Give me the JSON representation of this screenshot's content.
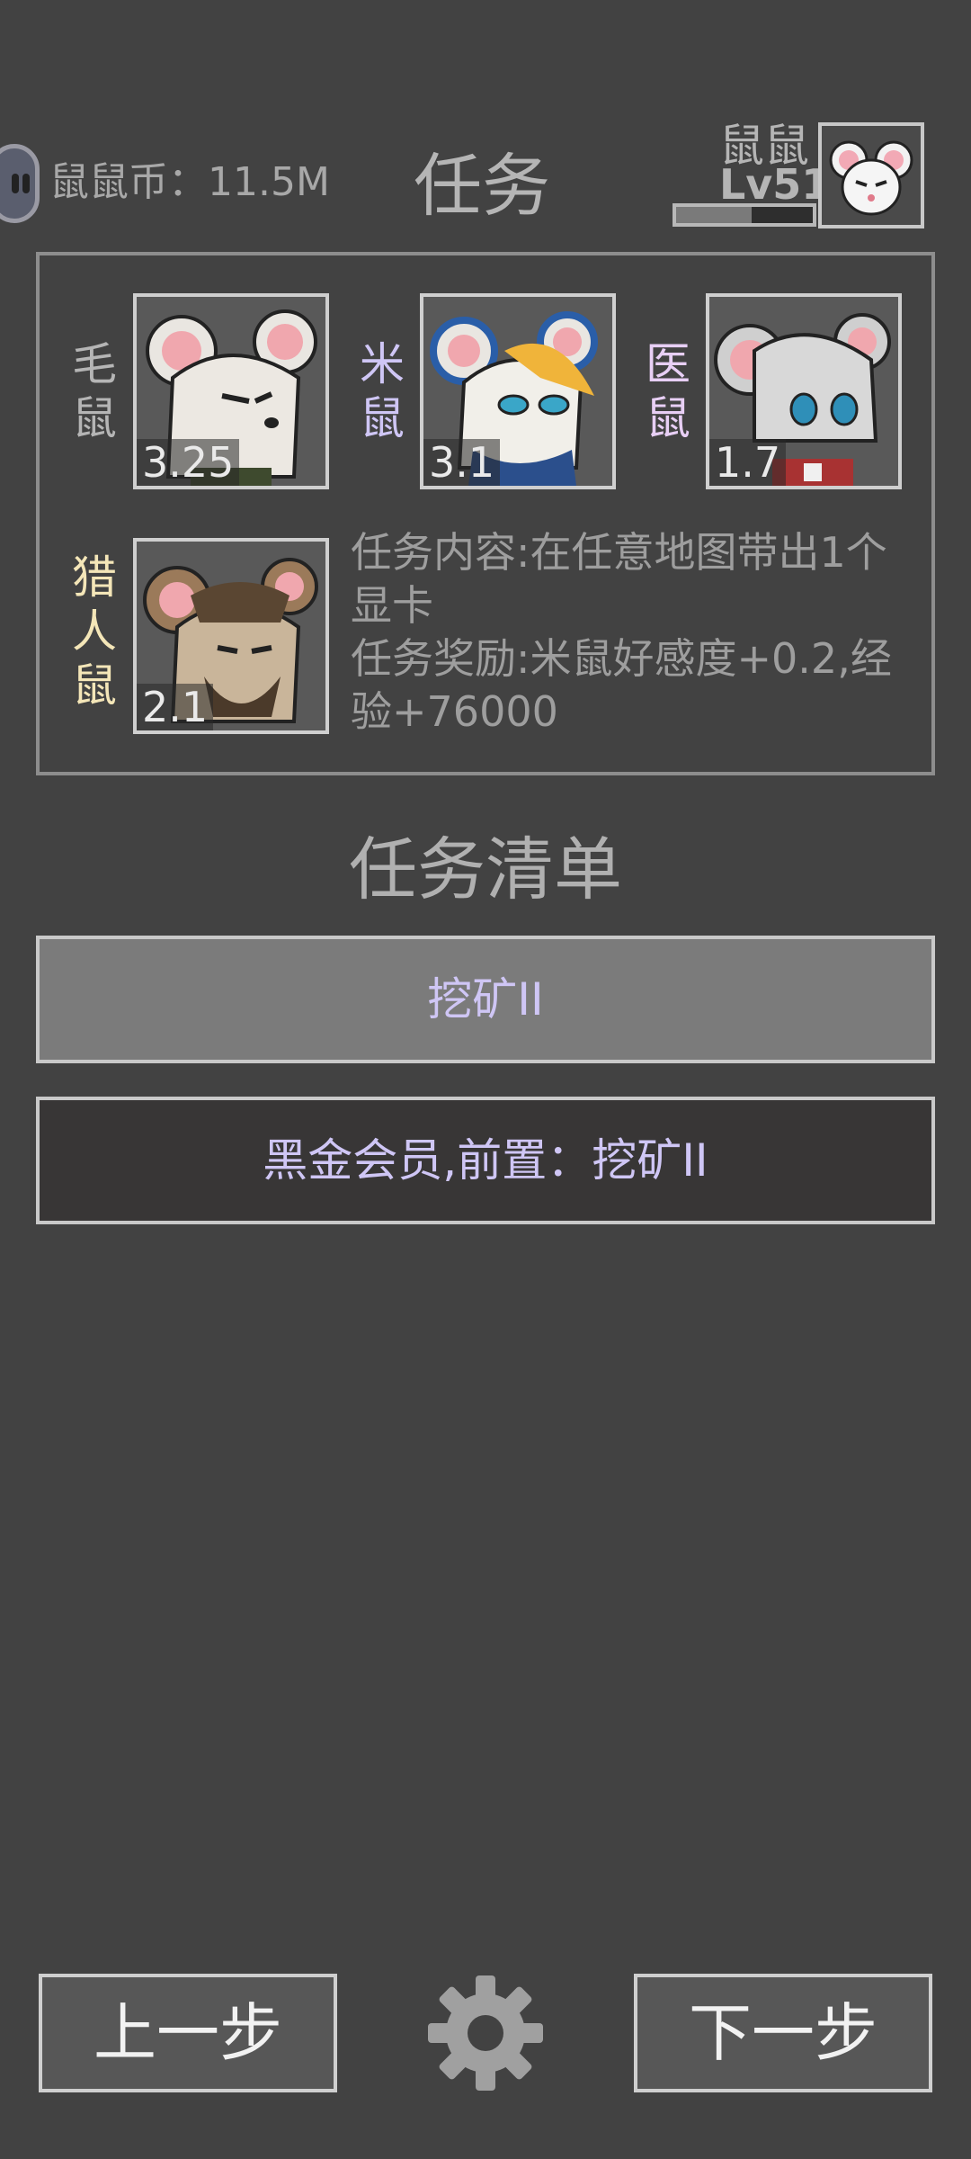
{
  "header": {
    "coin_text": "鼠鼠币：11.5M",
    "title": "任务",
    "player_name": "鼠鼠",
    "player_level": "Lv51",
    "xp_progress": 0.55
  },
  "characters": [
    {
      "name": "毛鼠",
      "affinity": "3.25",
      "name_color": "#b5b5b5"
    },
    {
      "name": "米鼠",
      "affinity": "3.1",
      "name_color": "#cfc6f5"
    },
    {
      "name": "医鼠",
      "affinity": "1.7",
      "name_color": "#e8cff5"
    },
    {
      "name": "猎人鼠",
      "affinity": "2.1",
      "name_color": "#f4e6b8"
    }
  ],
  "task": {
    "content": "任务内容:在任意地图带出1个显卡",
    "reward": "任务奖励:米鼠好感度+0.2,经验+76000"
  },
  "task_list": {
    "title": "任务清单",
    "items": [
      {
        "label": "挖矿II",
        "state": "selected"
      },
      {
        "label": "黑金会员,前置：挖矿II",
        "state": "locked"
      }
    ]
  },
  "nav": {
    "prev_label": "上一步",
    "next_label": "下一步"
  },
  "icons": {
    "coin": "coin-icon",
    "settings": "gear-icon"
  },
  "colors": {
    "background": "#424242",
    "item_text": "#cfc6f5",
    "selected_bg": "#7b7b7b",
    "locked_bg": "#383636"
  }
}
